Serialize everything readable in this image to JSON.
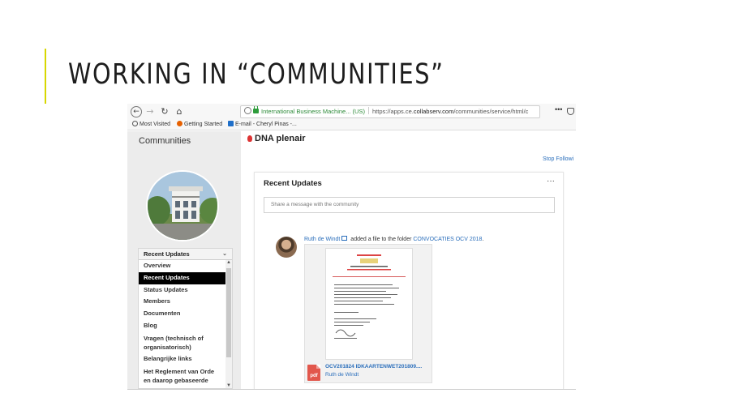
{
  "slide": {
    "title": "WORKING IN “COMMUNITIES”",
    "accent_color": "#d7d700"
  },
  "browser": {
    "back_icon": "arrow-left-icon",
    "forward_icon": "arrow-right-icon",
    "reload_icon": "reload-icon",
    "home_icon": "home-icon",
    "org_label": "International Business Machine... (US)",
    "url_prefix": "https://apps.ce.",
    "url_domain": "collabserv.com",
    "url_rest": "/communities/service/html/c",
    "menu_label": "•••",
    "bookmarks": [
      {
        "label": "Most Visited",
        "icon": "gear-icon"
      },
      {
        "label": "Getting Started",
        "icon": "firefox-icon"
      },
      {
        "label": "E-mail - Cheryl Pinas -...",
        "icon": "outlook-icon"
      }
    ]
  },
  "sidebar": {
    "title": "Communities",
    "nav_header": "Recent Updates",
    "nav_items": [
      {
        "label": "Overview"
      },
      {
        "label": "Recent Updates",
        "active": true
      },
      {
        "label": "Status Updates"
      },
      {
        "label": "Members"
      },
      {
        "label": "Documenten"
      },
      {
        "label": "Blog"
      },
      {
        "label": "Vragen (technisch of organisatorisch)"
      },
      {
        "label": "Belangrijke links"
      },
      {
        "label": "Het Reglement van Orde en daarop gebaseerde"
      }
    ]
  },
  "community": {
    "name": "DNA plenair",
    "stop_following": "Stop Followi"
  },
  "updates": {
    "title": "Recent Updates",
    "more": "···",
    "share_placeholder": "Share a message with the community",
    "entry": {
      "author": "Ruth de Windt",
      "action": " added a file to the folder ",
      "folder": "CONVOCATIES OCV 2018",
      "end": ".",
      "file_type": "pdf",
      "file_name": "OCV201824 IDKAARTENWET201809....",
      "file_owner": "Ruth de Windt"
    }
  },
  "colors": {
    "link": "#2a6ebb",
    "sidebar_bg": "#ececec",
    "active_bg": "#000000",
    "pdf": "#e2574c"
  }
}
